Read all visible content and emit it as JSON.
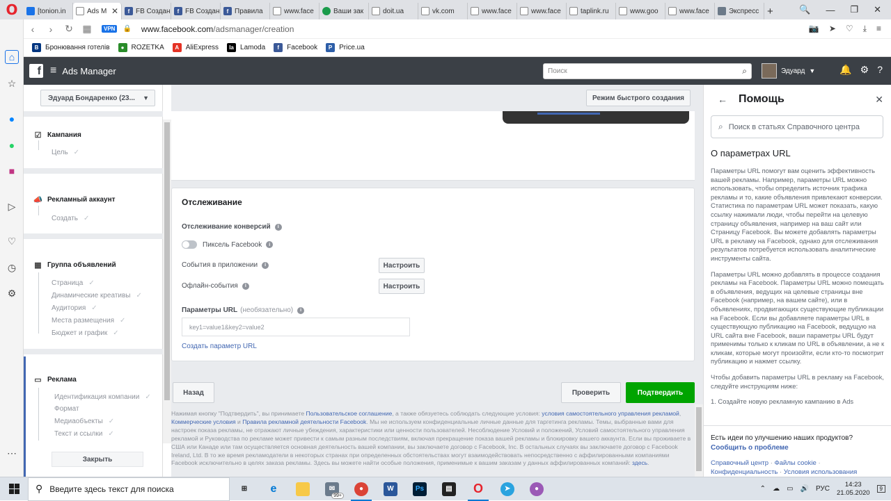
{
  "browser": {
    "tabs": [
      {
        "label": "[tonion.in",
        "icon": "chrome-icon",
        "color": "#1a73e8"
      },
      {
        "label": "Ads M",
        "icon": "document-icon",
        "active": true
      },
      {
        "label": "FB Создани",
        "icon": "facebook-icon"
      },
      {
        "label": "FB Создани",
        "icon": "facebook-icon"
      },
      {
        "label": "Правила",
        "icon": "facebook-icon"
      },
      {
        "label": "www.face",
        "icon": "document-icon"
      },
      {
        "label": "Ваши зак",
        "icon": "green-smile-icon"
      },
      {
        "label": "doit.ua",
        "icon": "document-icon"
      },
      {
        "label": "vk.com",
        "icon": "document-icon"
      },
      {
        "label": "www.face",
        "icon": "document-icon"
      },
      {
        "label": "www.face",
        "icon": "document-icon"
      },
      {
        "label": "taplink.ru",
        "icon": "document-icon"
      },
      {
        "label": "www.goo",
        "icon": "document-icon"
      },
      {
        "label": "www.face",
        "icon": "document-icon"
      },
      {
        "label": "Экспресс",
        "icon": "grid-icon"
      }
    ],
    "active_tab_close": "✕",
    "new_tab": "+",
    "window_controls": {
      "search": "🔍",
      "minimize": "—",
      "restore": "❐",
      "close": "✕"
    },
    "vpn": "VPN",
    "url_host": "www.facebook.com",
    "url_path": "/adsmanager/creation",
    "bookmarks": [
      {
        "label": "Бронювання готелів",
        "color": "#003580",
        "glyph": "B"
      },
      {
        "label": "ROZETKA",
        "color": "#2a8c2a",
        "glyph": "●"
      },
      {
        "label": "AliExpress",
        "color": "#e43225",
        "glyph": "A"
      },
      {
        "label": "Lamoda",
        "color": "#000000",
        "glyph": "la"
      },
      {
        "label": "Facebook",
        "color": "#3b5998",
        "glyph": "f"
      },
      {
        "label": "Price.ua",
        "color": "#2d5ea8",
        "glyph": "P"
      }
    ]
  },
  "fb": {
    "app_title": "Ads Manager",
    "search_placeholder": "Поиск",
    "user_name": "Эдуард"
  },
  "leftnav": {
    "account": "Эдуард Бондаренко (23...",
    "sections": [
      {
        "title": "Кампания",
        "items": [
          "Цель"
        ]
      },
      {
        "title": "Рекламный аккаунт",
        "items": [
          "Создать"
        ]
      },
      {
        "title": "Группа объявлений",
        "items": [
          "Страница",
          "Динамические креативы",
          "Аудитория",
          "Места размещения",
          "Бюджет и график"
        ]
      },
      {
        "title": "Реклама",
        "items": [
          "Идентификация компании",
          "Формат",
          "Медиаобъекты",
          "Текст и ссылки"
        ]
      }
    ],
    "close_label": "Закрыть"
  },
  "center": {
    "quick_mode": "Режим быстрого создания",
    "tracking_title": "Отслеживание",
    "conversion_label": "Отслеживание конверсий",
    "pixel_label": "Пиксель Facebook",
    "app_events_label": "События в приложении",
    "offline_events_label": "Офлайн-события",
    "configure_label": "Настроить",
    "url_params_label": "Параметры URL",
    "url_params_optional": "(необязательно)",
    "url_params_placeholder": "key1=value1&key2=value2",
    "create_param_link": "Создать параметр URL",
    "back_label": "Назад",
    "review_label": "Проверить",
    "confirm_label": "Подтвердить",
    "legal": {
      "t1": "Нажимая кнопку \"Подтвердить\", вы принимаете ",
      "l1": "Пользовательское соглашение",
      "t2": ", а также обязуетесь соблюдать следующие условия: ",
      "l2": "условия самостоятельного управления рекламой",
      "t3": ", ",
      "l3": "Коммерческие условия",
      "t4": " и ",
      "l4": "Правила рекламной деятельности Facebook",
      "t5": ". Мы не используем конфиденциальные личные данные для таргетинга рекламы. Темы, выбранные вами для настроек показа рекламы, не отражают личные убеждения, характеристики или ценности пользователей. Несоблюдение Условий и положений, Условий самостоятельного управления рекламой и Руководства по рекламе может привести к самым разным последствиям, включая прекращение показа вашей рекламы и блокировку вашего аккаунта. Если вы проживаете в США или Канаде или там осуществляется основная деятельность вашей компании, вы заключаете договор с Facebook, Inc. В остальных случаях вы заключаете договор с Facebook Ireland, Ltd. В то же время рекламодатели в некоторых странах при определенных обстоятельствах могут взаимодействовать непосредственно с аффилированными компаниями Facebook исключительно в целях заказа рекламы. Здесь вы можете найти особые положения, применимые к вашим заказам у данных аффилированных компаний: ",
      "l5": "здесь",
      "t6": "."
    }
  },
  "help": {
    "title": "Помощь",
    "search_placeholder": "Поиск в статьях Справочного центра",
    "article_title": "О параметрах URL",
    "p1": "Параметры URL помогут вам оценить эффективность вашей рекламы. Например, параметры URL можно использовать, чтобы определить источник трафика рекламы и то, какие объявления привлекают конверсии. Статистика по параметрам URL может показать, какую ссылку нажимали люди, чтобы перейти на целевую страницу объявления, например на ваш сайт или Страницу Facebook. Вы можете добавлять параметры URL в рекламу на Facebook, однако для отслеживания результатов потребуется использовать аналитические инструменты сайта.",
    "p2": "Параметры URL можно добавлять в процессе создания рекламы на Facebook. Параметры URL можно помещать в объявления, ведущих на целевые страницы вне Facebook (например, на вашем сайте), или в объявлениях, продвигающих существующие публикации на Facebook. Если вы добавляете параметры URL в существующую публикацию на Facebook, ведущую на URL сайта вне Facebook, ваши параметры URL будут применимы только к кликам по URL в объявлении, а не к кликам, которые могут произойти, если кто-то посмотрит публикацию и нажмет ссылку.",
    "p3": "Чтобы добавить параметры URL в рекламу на Facebook, следуйте инструкциям ниже:",
    "p4": "1. Создайте новую рекламную кампанию в Ads",
    "feedback_q": "Есть идеи по улучшению наших продуктов?",
    "report": "Сообщить о проблеме",
    "links": [
      "Справочный центр",
      "Файлы cookie",
      "Конфиденциальность",
      "Условия использования"
    ]
  },
  "taskbar": {
    "search_placeholder": "Введите здесь текст для поиска",
    "mail_badge": "99+",
    "lang": "РУС",
    "time": "14:23",
    "date": "21.05.2020",
    "notif_count": "9"
  },
  "colors": {
    "fb_blue": "#4267b2",
    "confirm_green": "#00a400",
    "header": "#3b4046"
  }
}
